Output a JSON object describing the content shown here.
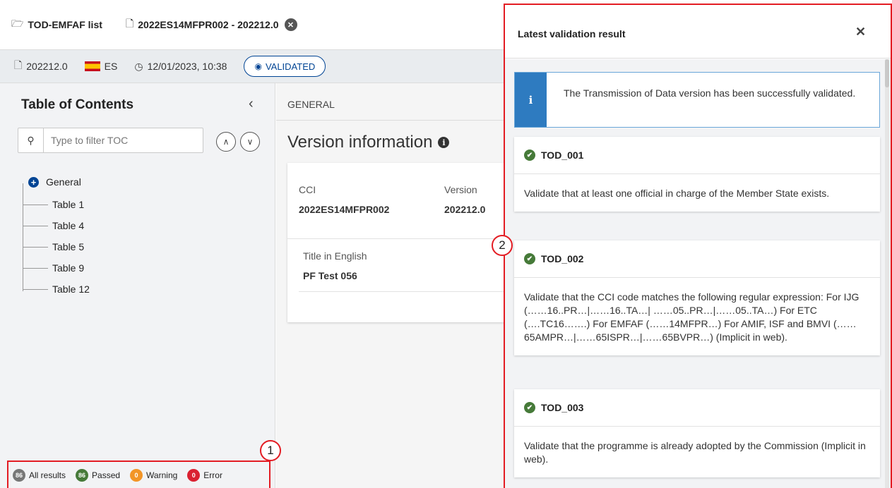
{
  "tabs": [
    {
      "label": "TOD-EMFAF list",
      "icon": "folder-open-icon"
    },
    {
      "label": "2022ES14MFPR002 - 202212.0",
      "icon": "file-icon"
    }
  ],
  "infobar": {
    "version": "202212.0",
    "country": "ES",
    "datetime": "12/01/2023, 10:38",
    "status": "VALIDATED"
  },
  "toc": {
    "title": "Table of Contents",
    "search_placeholder": "Type to filter TOC",
    "items": [
      "General",
      "Table 1",
      "Table 4",
      "Table 5",
      "Table 9",
      "Table 12"
    ]
  },
  "filters": [
    {
      "label": "All results",
      "count": "86",
      "color": "#777777"
    },
    {
      "label": "Passed",
      "count": "86",
      "color": "#467a39"
    },
    {
      "label": "Warning",
      "count": "0",
      "color": "#f29527"
    },
    {
      "label": "Error",
      "count": "0",
      "color": "#da2131"
    }
  ],
  "callouts": [
    "1",
    "2"
  ],
  "content": {
    "breadcrumb": "GENERAL",
    "page_title": "Version information",
    "cci_label": "CCI",
    "cci_value": "2022ES14MFPR002",
    "version_label": "Version",
    "version_value": "202212.0",
    "title_label": "Title in English",
    "title_value": "PF Test 056"
  },
  "validation": {
    "title": "Latest validation result",
    "notice": "The Transmission of Data version has been successfully validated.",
    "rules": [
      {
        "code": "TOD_001",
        "text": "Validate that at least one official in charge of the Member State exists."
      },
      {
        "code": "TOD_002",
        "text": "Validate that the CCI code matches the following regular expression: For IJG (……16..PR…|……16..TA…| ……05..PR…|……05..TA…) For ETC (….TC16…….) For EMFAF (……14MFPR…) For AMIF, ISF and BMVI (……65AMPR…|……65ISPR…|……65BVPR…) (Implicit in web)."
      },
      {
        "code": "TOD_003",
        "text": "Validate that the programme is already adopted by the Commission (Implicit in web)."
      }
    ]
  }
}
